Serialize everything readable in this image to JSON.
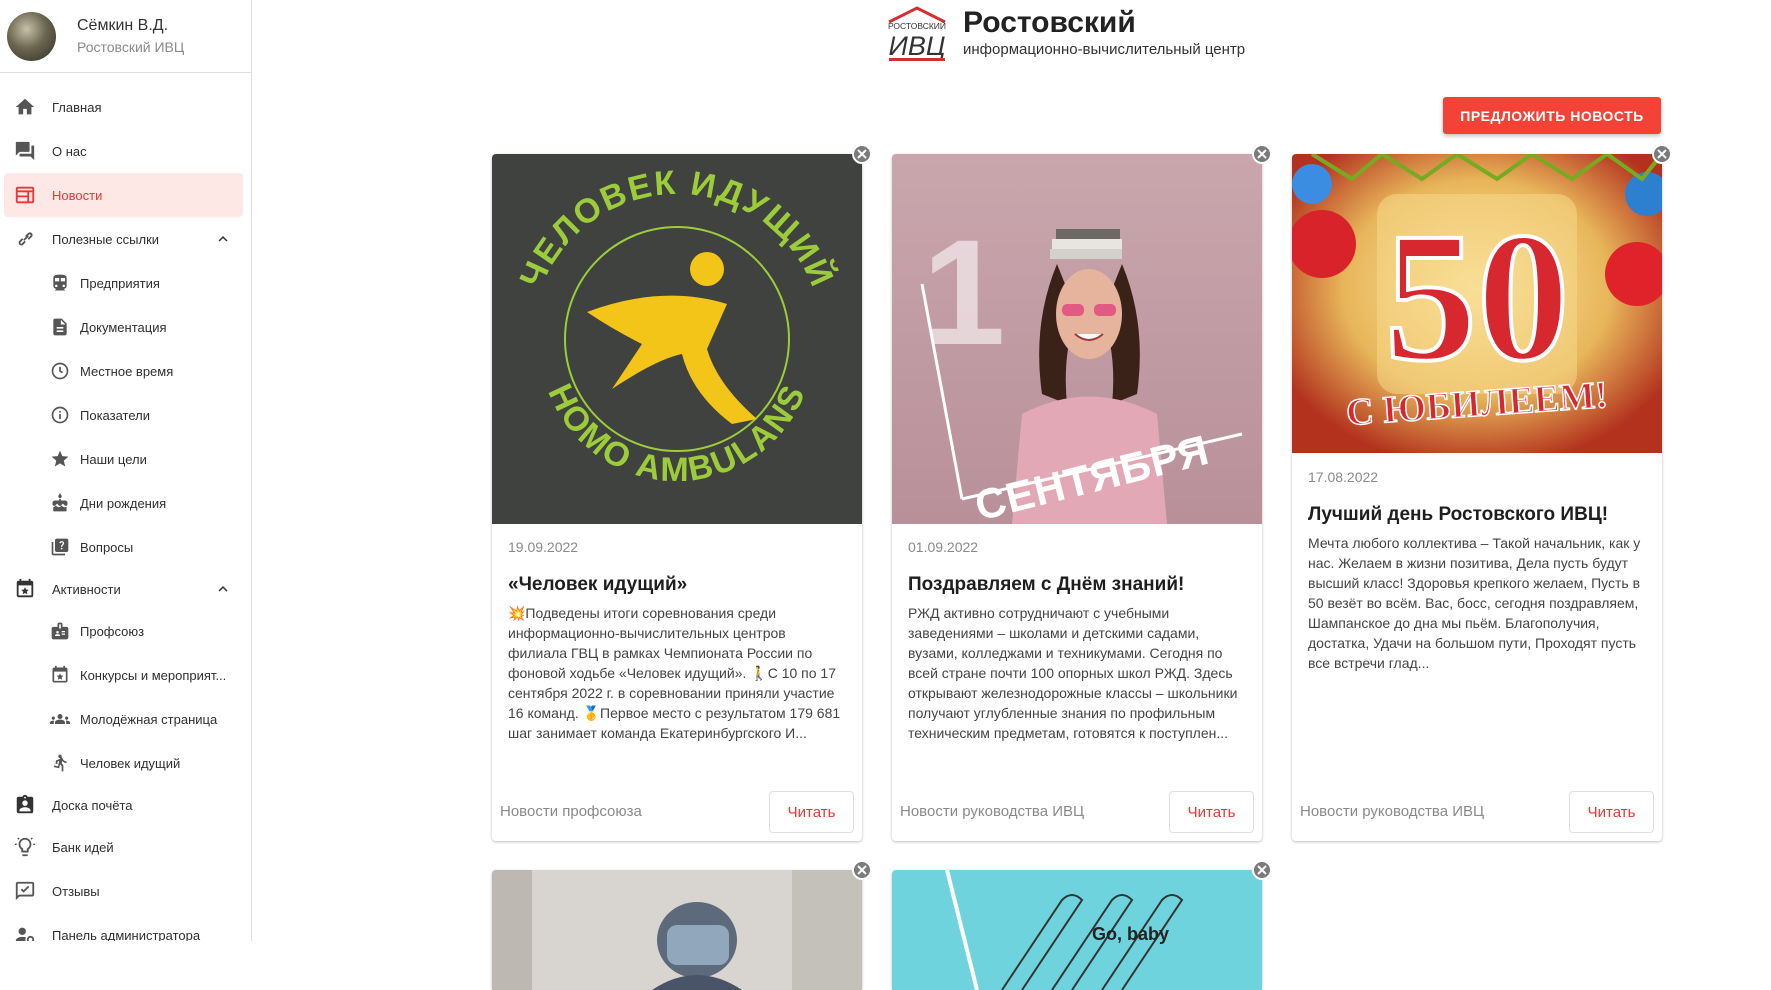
{
  "user": {
    "name": "Сёмкин В.Д.",
    "org": "Ростовский ИВЦ"
  },
  "nav": [
    {
      "label": "Главная",
      "icon": "home-icon"
    },
    {
      "label": "О нас",
      "icon": "forum-icon"
    },
    {
      "label": "Новости",
      "icon": "newspaper-icon",
      "active": true
    },
    {
      "label": "Полезные ссылки",
      "icon": "link-icon",
      "expanded": true
    },
    {
      "label": "Предприятия",
      "icon": "train-icon"
    },
    {
      "label": "Документация",
      "icon": "document-icon"
    },
    {
      "label": "Местное время",
      "icon": "clock-icon"
    },
    {
      "label": "Показатели",
      "icon": "info-icon"
    },
    {
      "label": "Наши цели",
      "icon": "star-icon"
    },
    {
      "label": "Дни рождения",
      "icon": "cake-icon"
    },
    {
      "label": "Вопросы",
      "icon": "question-icon"
    },
    {
      "label": "Активности",
      "icon": "calendar-icon",
      "expanded": true
    },
    {
      "label": "Профсоюз",
      "icon": "badge-icon"
    },
    {
      "label": "Конкурсы и мероприят...",
      "icon": "event-icon"
    },
    {
      "label": "Молодёжная страница",
      "icon": "people-icon"
    },
    {
      "label": "Человек идущий",
      "icon": "walk-icon"
    },
    {
      "label": "Доска почёта",
      "icon": "honor-board-icon"
    },
    {
      "label": "Банк идей",
      "icon": "lightbulb-icon"
    },
    {
      "label": "Отзывы",
      "icon": "feedback-icon"
    },
    {
      "label": "Панель администратора",
      "icon": "admin-icon"
    }
  ],
  "header": {
    "logo_top": "РОСТОВСКИЙ",
    "logo_main": "ИВЦ",
    "title": "Ростовский",
    "subtitle": "информационно-вычислительный центр"
  },
  "suggest_button": "ПРЕДЛОЖИТЬ НОВОСТЬ",
  "cards": [
    {
      "date": "19.09.2022",
      "title": "«Человек идущий»",
      "text": "💥Подведены итоги соревнования среди информационно-вычислительных центров филиала ГВЦ в рамках Чемпионата России по фоновой ходьбе «Человек идущий». 🚶С 10 по 17 сентября 2022 г. в соревновании приняли участие 16 команд. 🥇Первое место с результатом 179 681 шаг занимает команда Екатеринбургского И...",
      "category": "Новости профсоюза",
      "read": "Читать",
      "image_text_top": "ЧЕЛОВЕК ИДУЩИЙ",
      "image_text_bottom": "HOMO AMBULANS"
    },
    {
      "date": "01.09.2022",
      "title": "Поздравляем с Днём знаний!",
      "text": "РЖД активно сотрудничают с учебными заведениями – школами и детскими садами, вузами, колледжами и техникумами. Сегодня по всей стране почти 100 опорных школ РЖД. Здесь открывают железнодорожные классы – школьники получают углубленные знания по профильным техническим предметам, готовятся к поступлен...",
      "category": "Новости руководства ИВЦ",
      "read": "Читать",
      "image_num": "1",
      "image_text": "СЕНТЯБРЯ"
    },
    {
      "date": "17.08.2022",
      "title": "Лучший день Ростовского ИВЦ!",
      "text": "Мечта любого коллектива – Такой начальник, как у нас. Желаем в жизни позитива, Дела пусть будут высший класс! Здоровья крепкого желаем, Пусть в 50 везёт во всём. Вас, босс, сегодня поздравляем, Шампанское до дна мы пьём. Благополучия, достатка, Удачи на большом пути, Проходят пусть все встречи глад...",
      "category": "Новости руководства ИВЦ",
      "read": "Читать",
      "image_num": "50",
      "image_text": "С ЮБИЛЕЕМ!"
    },
    {
      "image_text": ""
    },
    {
      "image_text": "Go, baby"
    }
  ],
  "colors": {
    "accent": "#f44336",
    "active_bg": "#fde8e6",
    "muted": "#8a8a8a"
  }
}
